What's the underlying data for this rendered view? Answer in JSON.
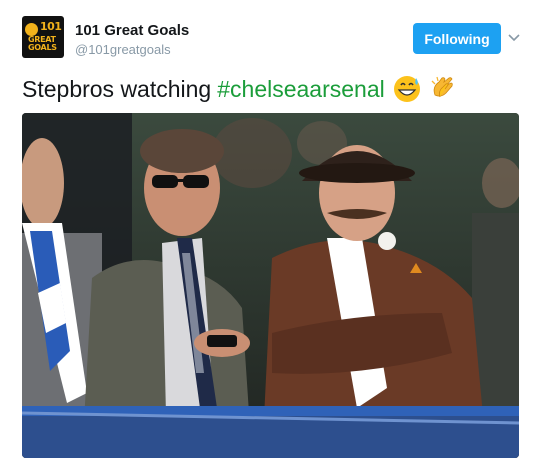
{
  "account": {
    "name": "101 Great Goals",
    "handle": "@101greatgoals",
    "avatar_text_line1": "101",
    "avatar_text_line2": "GREAT\nGOALS"
  },
  "follow_button": {
    "label": "Following"
  },
  "tweet": {
    "text": "Stepbros watching",
    "hashtag": "#chelseaarsenal",
    "emojis": [
      "grinning-sweat-emoji",
      "clapping-hands-emoji"
    ]
  },
  "colors": {
    "accent": "#1da1f2",
    "hashtag": "#1b9d3a",
    "handle": "#8899a6"
  },
  "media": {
    "description_icon": "photo"
  }
}
